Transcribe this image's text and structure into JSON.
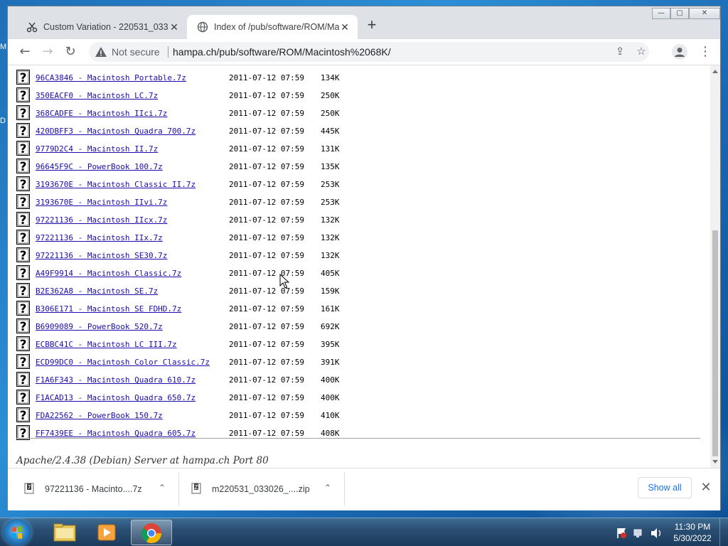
{
  "browser": {
    "tabs": [
      {
        "title": "Custom Variation - 220531_0330...",
        "icon": "scissors-icon",
        "active": false
      },
      {
        "title": "Index of /pub/software/ROM/Ma...",
        "icon": "globe-icon",
        "active": true
      }
    ],
    "new_tab_label": "+",
    "security_label": "Not secure",
    "url": "hampa.ch/pub/software/ROM/Macintosh%2068K/"
  },
  "files": [
    {
      "name": "96CA3846 - Macintosh Portable.7z",
      "date": "2011-07-12 07:59",
      "size": "134K"
    },
    {
      "name": "350EACF0 - Macintosh LC.7z",
      "date": "2011-07-12 07:59",
      "size": "250K"
    },
    {
      "name": "368CADFE - Macintosh IIci.7z",
      "date": "2011-07-12 07:59",
      "size": "250K"
    },
    {
      "name": "420DBFF3 - Macintosh Quadra 700.7z",
      "date": "2011-07-12 07:59",
      "size": "445K"
    },
    {
      "name": "9779D2C4 - Macintosh II.7z",
      "date": "2011-07-12 07:59",
      "size": "131K"
    },
    {
      "name": "96645F9C - PowerBook 100.7z",
      "date": "2011-07-12 07:59",
      "size": "135K"
    },
    {
      "name": "3193670E - Macintosh Classic II.7z",
      "date": "2011-07-12 07:59",
      "size": "253K"
    },
    {
      "name": "3193670E - Macintosh IIvi.7z",
      "date": "2011-07-12 07:59",
      "size": "253K"
    },
    {
      "name": "97221136 - Macintosh IIcx.7z",
      "date": "2011-07-12 07:59",
      "size": "132K"
    },
    {
      "name": "97221136 - Macintosh IIx.7z",
      "date": "2011-07-12 07:59",
      "size": "132K"
    },
    {
      "name": "97221136 - Macintosh SE30.7z",
      "date": "2011-07-12 07:59",
      "size": "132K"
    },
    {
      "name": "A49F9914 - Macintosh Classic.7z",
      "date": "2011-07-12 07:59",
      "size": "405K"
    },
    {
      "name": "B2E362A8 - Macintosh SE.7z",
      "date": "2011-07-12 07:59",
      "size": "159K"
    },
    {
      "name": "B306E171 - Macintosh SE FDHD.7z",
      "date": "2011-07-12 07:59",
      "size": "161K"
    },
    {
      "name": "B6909089 - PowerBook 520.7z",
      "date": "2011-07-12 07:59",
      "size": "692K"
    },
    {
      "name": "ECBBC41C - Macintosh LC III.7z",
      "date": "2011-07-12 07:59",
      "size": "395K"
    },
    {
      "name": "ECD99DC0 - Macintosh Color Classic.7z",
      "date": "2011-07-12 07:59",
      "size": "391K"
    },
    {
      "name": "F1A6F343 - Macintosh Quadra 610.7z",
      "date": "2011-07-12 07:59",
      "size": "400K"
    },
    {
      "name": "F1ACAD13 - Macintosh Quadra 650.7z",
      "date": "2011-07-12 07:59",
      "size": "400K"
    },
    {
      "name": "FDA22562 - PowerBook 150.7z",
      "date": "2011-07-12 07:59",
      "size": "410K"
    },
    {
      "name": "FF7439EE - Macintosh Quadra 605.7z",
      "date": "2011-07-12 07:59",
      "size": "408K"
    }
  ],
  "server_signature": "Apache/2.4.38 (Debian) Server at hampa.ch Port 80",
  "downloads": {
    "items": [
      {
        "name": "97221136 - Macinto....7z",
        "icon": "archive-file-icon"
      },
      {
        "name": "m220531_033026_....zip",
        "icon": "archive-file-icon"
      }
    ],
    "show_all_label": "Show all"
  },
  "taskbar": {
    "apps": [
      "explorer-icon",
      "media-player-icon",
      "chrome-icon"
    ],
    "time": "11:30 PM",
    "date": "5/30/2022"
  },
  "colors": {
    "link": "#1a0dab",
    "show_all": "#1a73e8",
    "desktop": "#1e6fb8"
  }
}
